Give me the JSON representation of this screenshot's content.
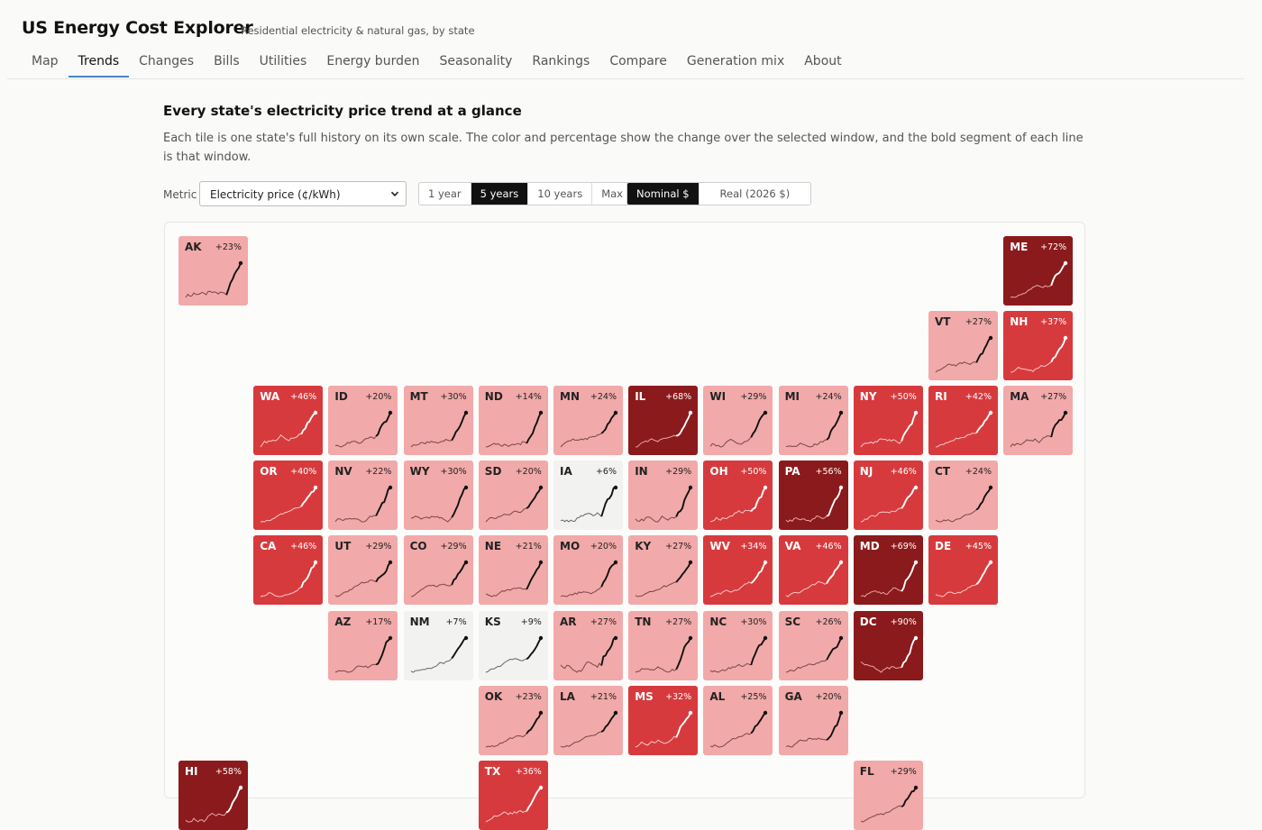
{
  "app": {
    "title": "US Energy Cost Explorer",
    "subtitle": "Residential electricity & natural gas, by state"
  },
  "nav": {
    "tabs": [
      "Map",
      "Trends",
      "Changes",
      "Bills",
      "Utilities",
      "Energy burden",
      "Seasonality",
      "Rankings",
      "Compare",
      "Generation mix",
      "About"
    ],
    "active": "Trends"
  },
  "section": {
    "title": "Every state's electricity price trend at a glance",
    "description": "Each tile is one state's full history on its own scale. The color and percentage show the change over the selected window, and the bold segment of each line is that window."
  },
  "controls": {
    "metric_label": "Metric",
    "metric_value": "Electricity price (¢/kWh)",
    "period_options": [
      "1 year",
      "5 years",
      "10 years",
      "Max"
    ],
    "period_active": "5 years",
    "dollar_options": [
      "Nominal $",
      "Real (2026 $)"
    ],
    "dollar_active": "Nominal $"
  },
  "colors": {
    "low": "#f2f2f0",
    "light": "#f2a9a9",
    "medium": "#d73a3d",
    "dark": "#8b1a1c"
  },
  "tiles": [
    {
      "abbr": "AK",
      "pct": "+23%",
      "row": 0,
      "col": 0
    },
    {
      "abbr": "ME",
      "pct": "+72%",
      "row": 0,
      "col": 11
    },
    {
      "abbr": "VT",
      "pct": "+27%",
      "row": 1,
      "col": 10
    },
    {
      "abbr": "NH",
      "pct": "+37%",
      "row": 1,
      "col": 11
    },
    {
      "abbr": "WA",
      "pct": "+46%",
      "row": 2,
      "col": 1
    },
    {
      "abbr": "ID",
      "pct": "+20%",
      "row": 2,
      "col": 2
    },
    {
      "abbr": "MT",
      "pct": "+30%",
      "row": 2,
      "col": 3
    },
    {
      "abbr": "ND",
      "pct": "+14%",
      "row": 2,
      "col": 4
    },
    {
      "abbr": "MN",
      "pct": "+24%",
      "row": 2,
      "col": 5
    },
    {
      "abbr": "IL",
      "pct": "+68%",
      "row": 2,
      "col": 6
    },
    {
      "abbr": "WI",
      "pct": "+29%",
      "row": 2,
      "col": 7
    },
    {
      "abbr": "MI",
      "pct": "+24%",
      "row": 2,
      "col": 8
    },
    {
      "abbr": "NY",
      "pct": "+50%",
      "row": 2,
      "col": 9
    },
    {
      "abbr": "RI",
      "pct": "+42%",
      "row": 2,
      "col": 10
    },
    {
      "abbr": "MA",
      "pct": "+27%",
      "row": 2,
      "col": 11
    },
    {
      "abbr": "OR",
      "pct": "+40%",
      "row": 3,
      "col": 1
    },
    {
      "abbr": "NV",
      "pct": "+22%",
      "row": 3,
      "col": 2
    },
    {
      "abbr": "WY",
      "pct": "+30%",
      "row": 3,
      "col": 3
    },
    {
      "abbr": "SD",
      "pct": "+20%",
      "row": 3,
      "col": 4
    },
    {
      "abbr": "IA",
      "pct": "+6%",
      "row": 3,
      "col": 5
    },
    {
      "abbr": "IN",
      "pct": "+29%",
      "row": 3,
      "col": 6
    },
    {
      "abbr": "OH",
      "pct": "+50%",
      "row": 3,
      "col": 7
    },
    {
      "abbr": "PA",
      "pct": "+56%",
      "row": 3,
      "col": 8
    },
    {
      "abbr": "NJ",
      "pct": "+46%",
      "row": 3,
      "col": 9
    },
    {
      "abbr": "CT",
      "pct": "+24%",
      "row": 3,
      "col": 10
    },
    {
      "abbr": "CA",
      "pct": "+46%",
      "row": 4,
      "col": 1
    },
    {
      "abbr": "UT",
      "pct": "+29%",
      "row": 4,
      "col": 2
    },
    {
      "abbr": "CO",
      "pct": "+29%",
      "row": 4,
      "col": 3
    },
    {
      "abbr": "NE",
      "pct": "+21%",
      "row": 4,
      "col": 4
    },
    {
      "abbr": "MO",
      "pct": "+20%",
      "row": 4,
      "col": 5
    },
    {
      "abbr": "KY",
      "pct": "+27%",
      "row": 4,
      "col": 6
    },
    {
      "abbr": "WV",
      "pct": "+34%",
      "row": 4,
      "col": 7
    },
    {
      "abbr": "VA",
      "pct": "+46%",
      "row": 4,
      "col": 8
    },
    {
      "abbr": "MD",
      "pct": "+69%",
      "row": 4,
      "col": 9
    },
    {
      "abbr": "DE",
      "pct": "+45%",
      "row": 4,
      "col": 10
    },
    {
      "abbr": "AZ",
      "pct": "+17%",
      "row": 5,
      "col": 2
    },
    {
      "abbr": "NM",
      "pct": "+7%",
      "row": 5,
      "col": 3
    },
    {
      "abbr": "KS",
      "pct": "+9%",
      "row": 5,
      "col": 4
    },
    {
      "abbr": "AR",
      "pct": "+27%",
      "row": 5,
      "col": 5
    },
    {
      "abbr": "TN",
      "pct": "+27%",
      "row": 5,
      "col": 6
    },
    {
      "abbr": "NC",
      "pct": "+30%",
      "row": 5,
      "col": 7
    },
    {
      "abbr": "SC",
      "pct": "+26%",
      "row": 5,
      "col": 8
    },
    {
      "abbr": "DC",
      "pct": "+90%",
      "row": 5,
      "col": 9
    },
    {
      "abbr": "OK",
      "pct": "+23%",
      "row": 6,
      "col": 4
    },
    {
      "abbr": "LA",
      "pct": "+21%",
      "row": 6,
      "col": 5
    },
    {
      "abbr": "MS",
      "pct": "+32%",
      "row": 6,
      "col": 6
    },
    {
      "abbr": "AL",
      "pct": "+25%",
      "row": 6,
      "col": 7
    },
    {
      "abbr": "GA",
      "pct": "+20%",
      "row": 6,
      "col": 8
    },
    {
      "abbr": "HI",
      "pct": "+58%",
      "row": 7,
      "col": 0
    },
    {
      "abbr": "TX",
      "pct": "+36%",
      "row": 7,
      "col": 4
    },
    {
      "abbr": "FL",
      "pct": "+29%",
      "row": 7,
      "col": 9
    }
  ]
}
